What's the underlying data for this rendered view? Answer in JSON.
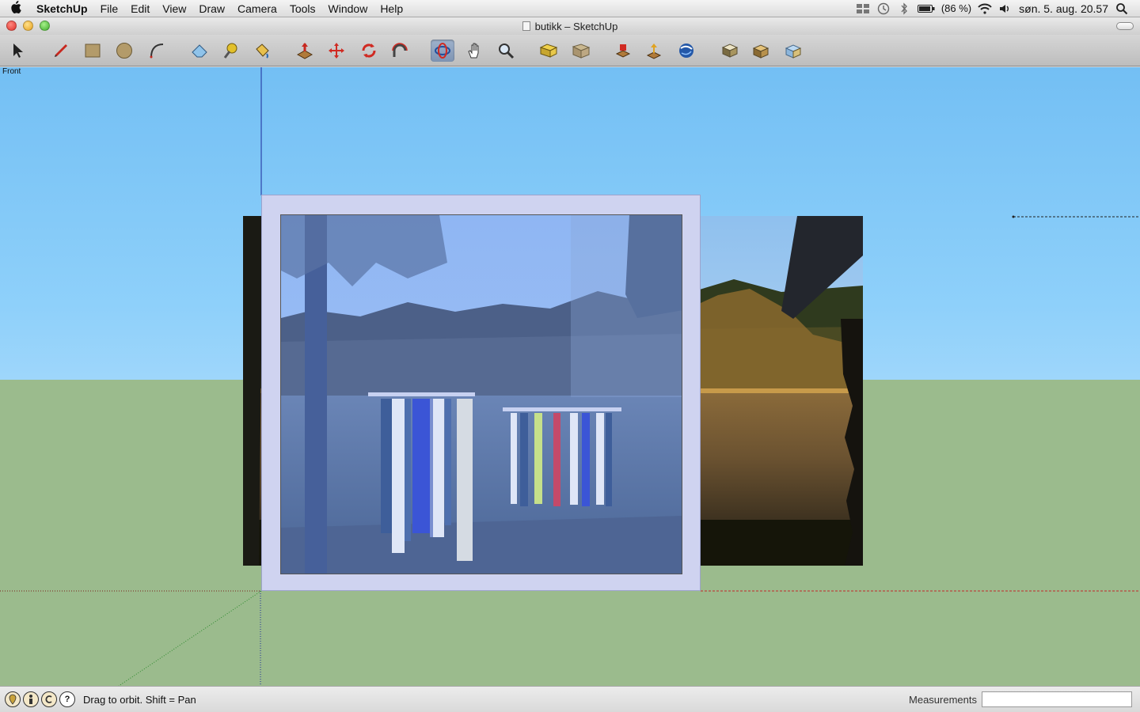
{
  "menubar": {
    "app_name": "SketchUp",
    "items": [
      "File",
      "Edit",
      "View",
      "Draw",
      "Camera",
      "Tools",
      "Window",
      "Help"
    ],
    "battery": "(86 %)",
    "clock": "søn. 5. aug. 20.57"
  },
  "window": {
    "title": "butikk – SketchUp"
  },
  "toolbar": {
    "tools": [
      "select-tool",
      "pencil-tool",
      "rectangle-tool",
      "circle-tool",
      "arc-tool",
      "eraser-tool",
      "tape-measure-tool",
      "paint-bucket-tool",
      "push-pull-tool",
      "move-tool",
      "rotate-tool",
      "follow-me-tool",
      "orbit-tool",
      "pan-tool",
      "zoom-tool",
      "section-plane-tool",
      "section-display-tool",
      "get-models-tool",
      "share-model-tool",
      "google-earth-tool",
      "components-tool",
      "add-location-tool",
      "add-building-tool"
    ],
    "active_tool": "orbit-tool"
  },
  "viewport": {
    "scene_label": "Front"
  },
  "statusbar": {
    "hint": "Drag to orbit.  Shift = Pan",
    "measurements_label": "Measurements",
    "measurements_value": ""
  },
  "colors": {
    "sky": "#8ed0fa",
    "ground": "#9bbb8d",
    "panel": "#cfd3f0",
    "active_tool": "#8ea3c1"
  }
}
